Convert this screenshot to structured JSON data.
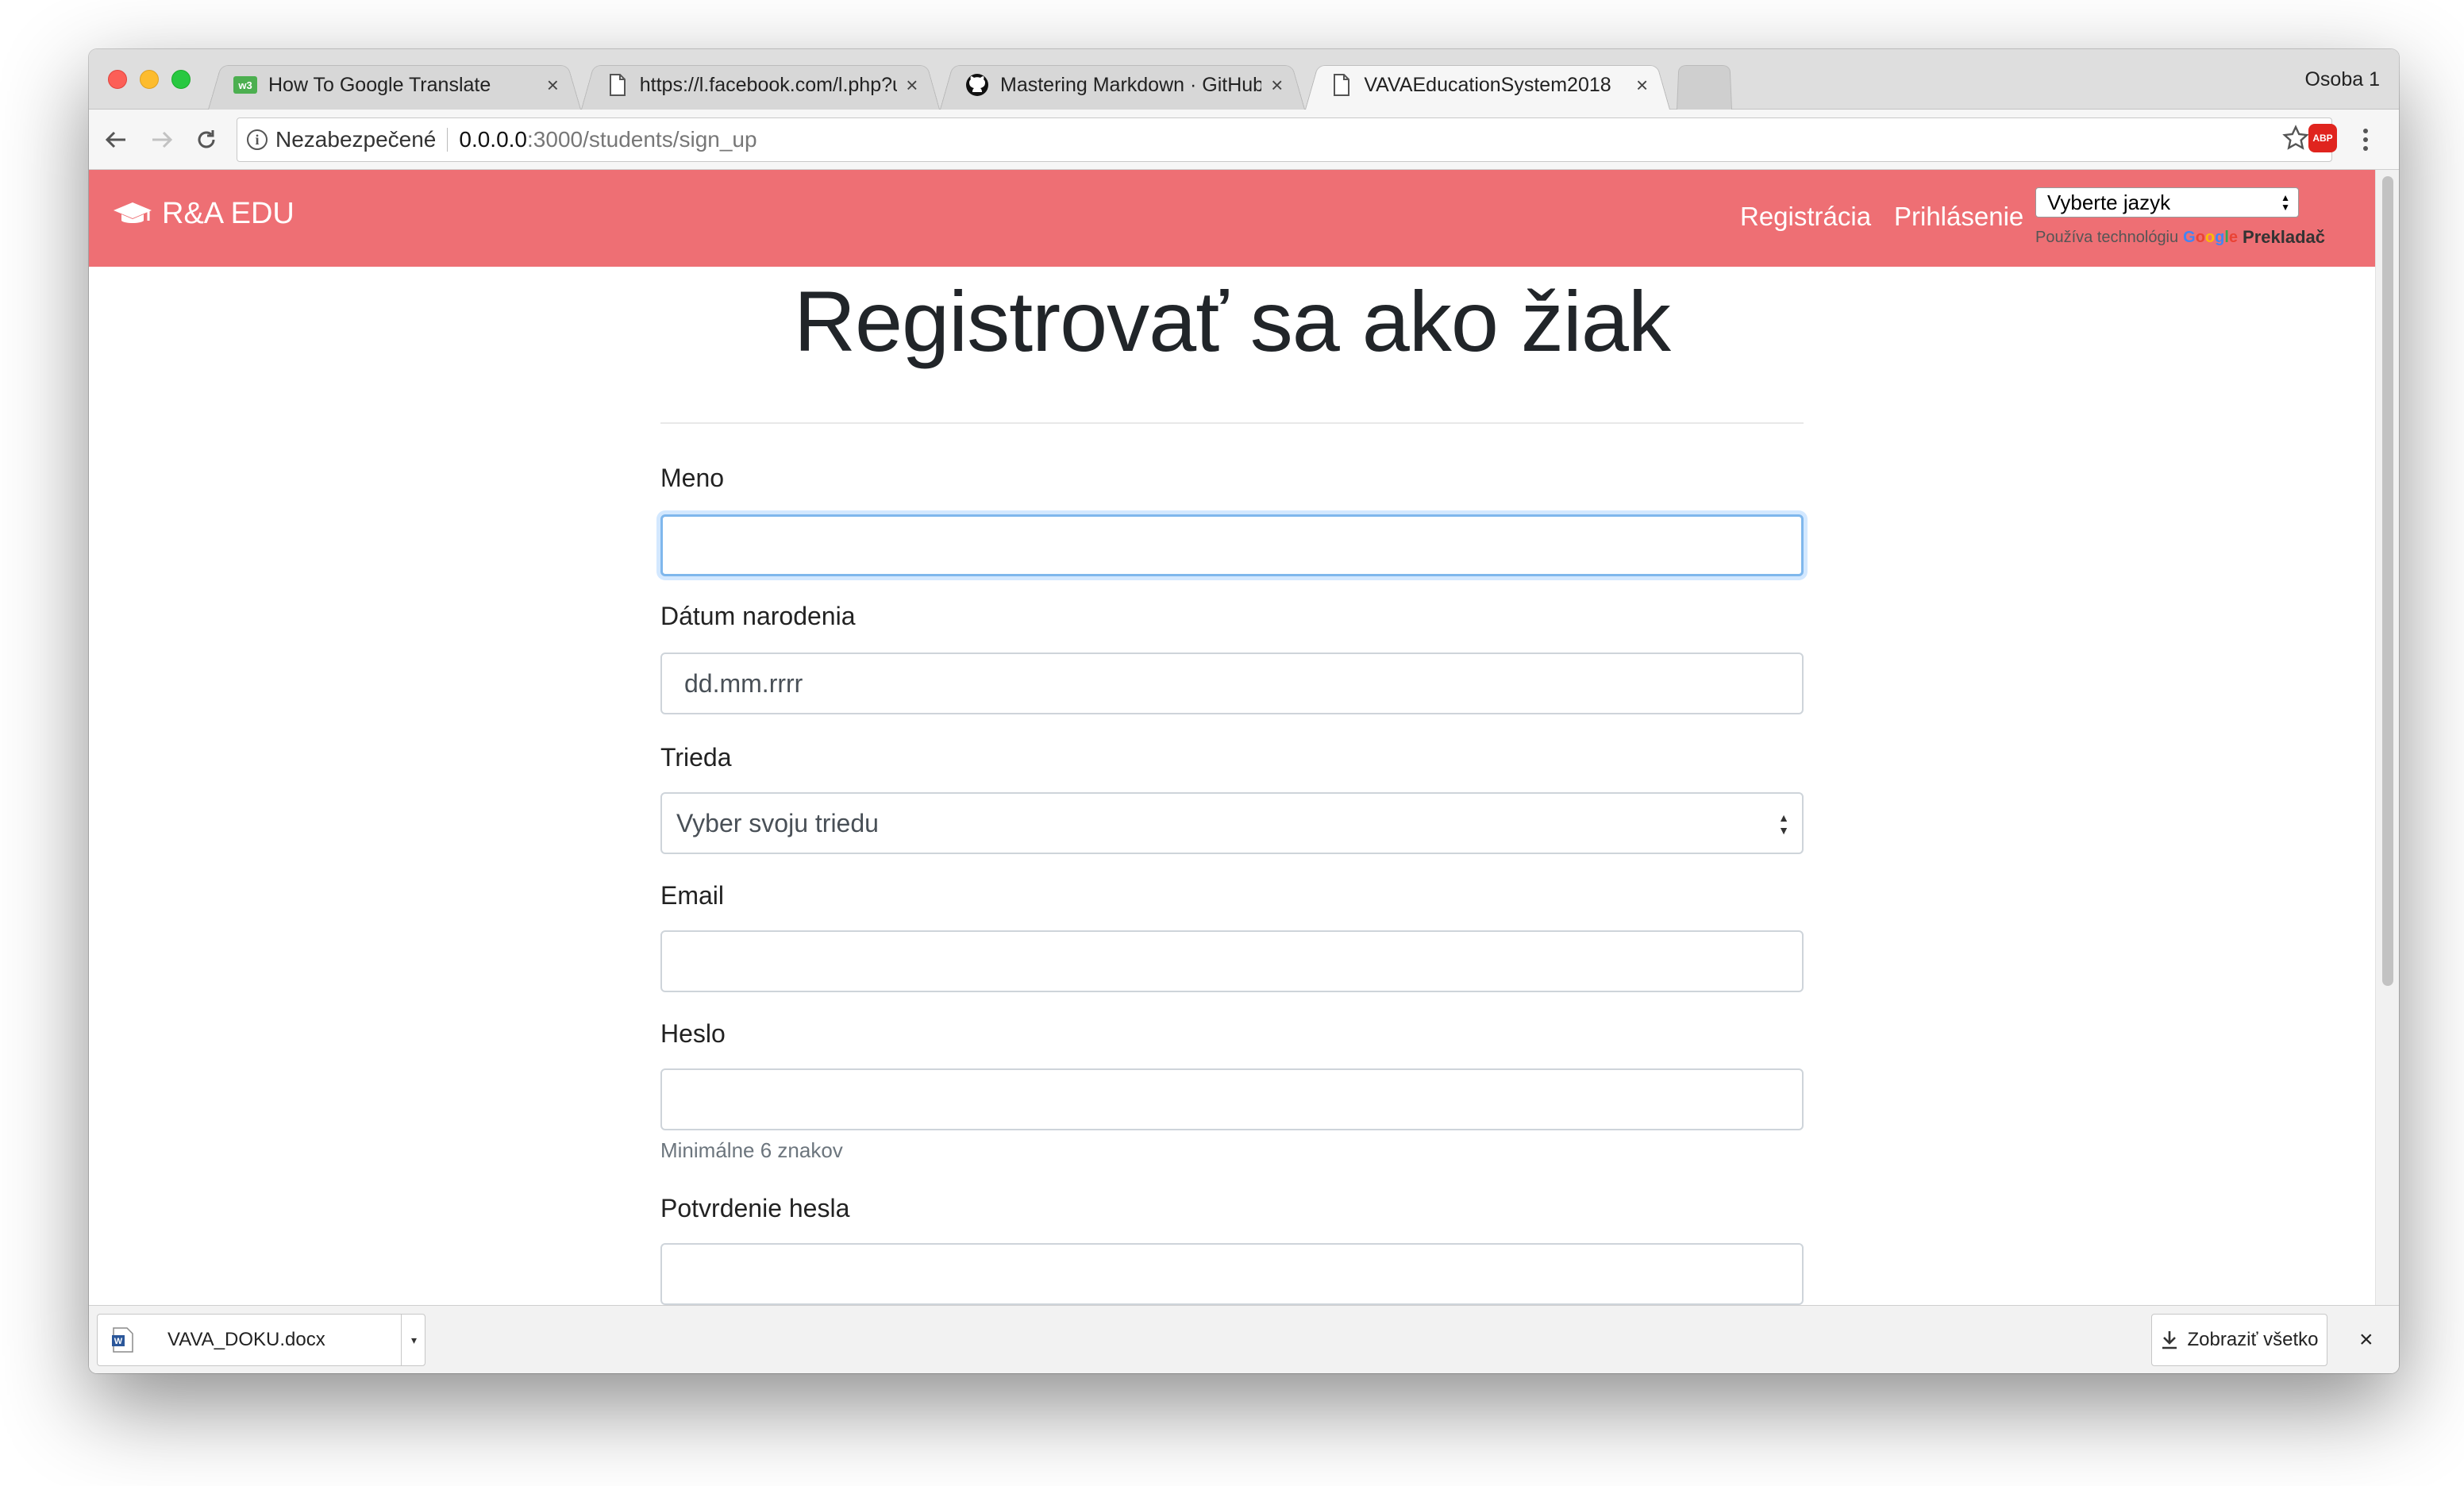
{
  "browser": {
    "tabs": [
      {
        "title": "How To Google Translate",
        "favicon": "w3-favicon",
        "active": false
      },
      {
        "title": "https://l.facebook.com/l.php?u",
        "favicon": "page-icon",
        "active": false
      },
      {
        "title": "Mastering Markdown · GitHub",
        "favicon": "github-icon",
        "active": false
      },
      {
        "title": "VAVAEducationSystem2018",
        "favicon": "page-icon",
        "active": true
      }
    ],
    "profile": "Osoba 1",
    "close_glyph": "×",
    "security_label": "Nezabezpečené",
    "url_host": "0.0.0.0",
    "url_path": ":3000/students/sign_up"
  },
  "site": {
    "brand": "R&A EDU",
    "nav": {
      "register": "Registrácia",
      "login": "Prihlásenie"
    },
    "translate": {
      "select_value": "Vyberte jazyk",
      "powered_prefix": "Používa technológiu",
      "google": "Google",
      "product": "Prekladač"
    },
    "colors": {
      "brand": "#ee6f74",
      "focus": "#7fb7ec"
    }
  },
  "form": {
    "heading": "Registrovať sa ako žiak",
    "name_label": "Meno",
    "name_value": "",
    "dob_label": "Dátum narodenia",
    "dob_value": "dd.mm.rrrr",
    "class_label": "Trieda",
    "class_value": "Vyber svoju triedu",
    "email_label": "Email",
    "email_value": "",
    "password_label": "Heslo",
    "password_value": "",
    "password_help": "Minimálne 6 znakov",
    "confirm_label": "Potvrdenie hesla",
    "confirm_value": ""
  },
  "downloads": {
    "file": "VAVA_DOKU.docx",
    "show_all": "Zobraziť všetko",
    "close_glyph": "×"
  }
}
